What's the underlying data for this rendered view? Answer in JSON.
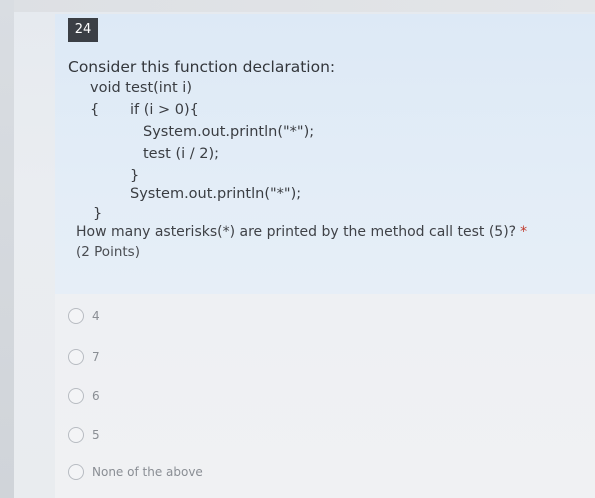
{
  "question": {
    "number": "24",
    "title": "Consider this function declaration:",
    "code_lines": [
      "void test(int i)",
      "{",
      "if (i > 0){",
      "System.out.println(\"*\");",
      "test (i / 2);",
      "}",
      "System.out.println(\"*\");",
      "}"
    ],
    "prompt": "How many asterisks(*) are printed by the method call test (5)?",
    "required_marker": "*",
    "points": "(2 Points)"
  },
  "options": [
    {
      "label": "4"
    },
    {
      "label": "7"
    },
    {
      "label": "6"
    },
    {
      "label": "5"
    },
    {
      "label": "None of the above"
    }
  ],
  "colors": {
    "question_card_bg": "#e0ebf6",
    "number_badge_bg": "#3b3f45",
    "required_star": "#c0392b"
  }
}
